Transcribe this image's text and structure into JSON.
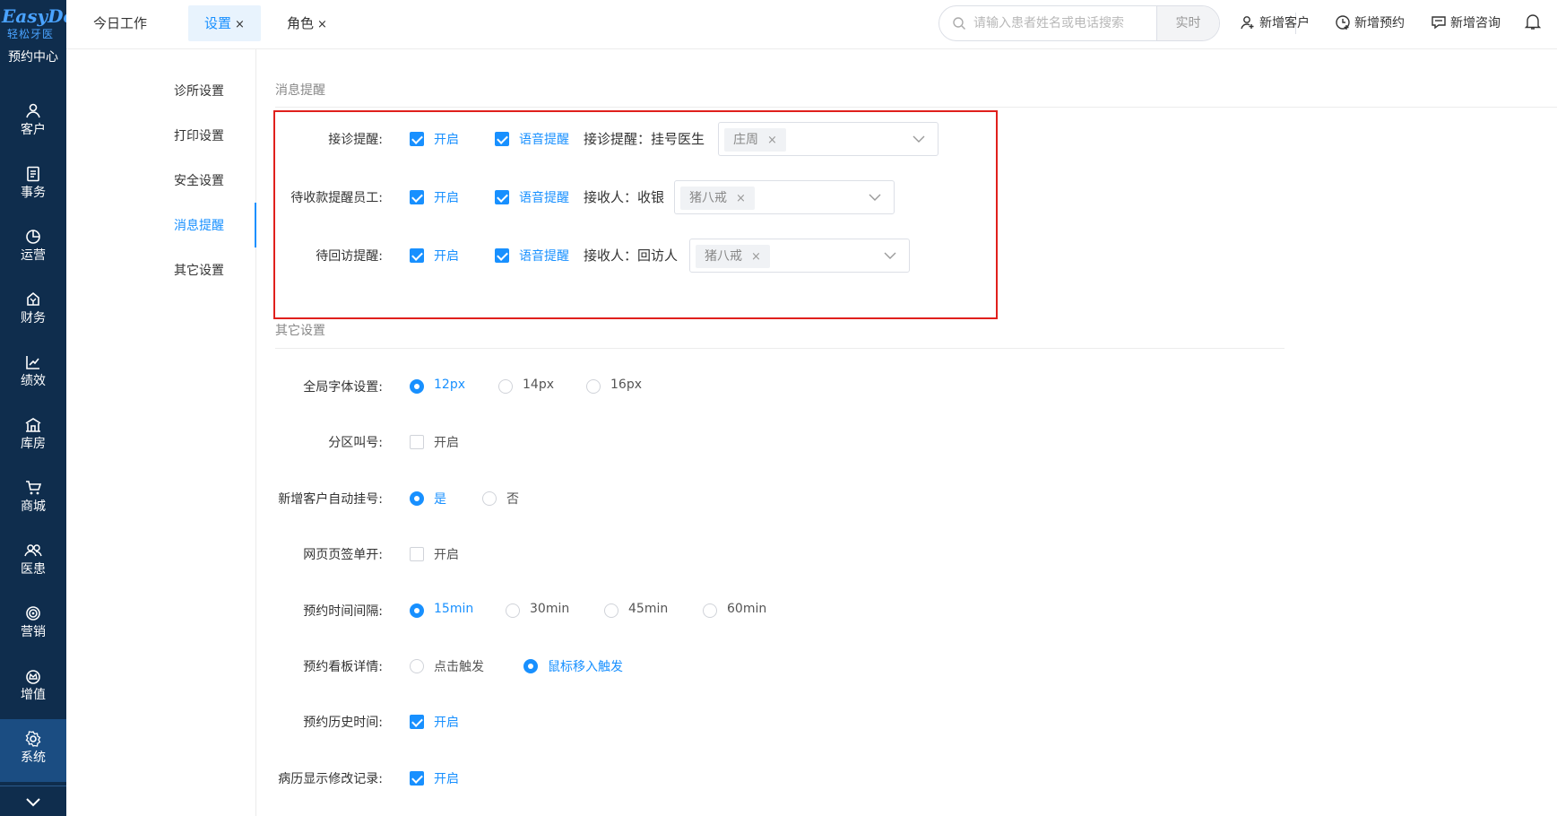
{
  "brand": {
    "name": "EasyDent",
    "subtitle": "轻松牙医"
  },
  "leftnav": {
    "appointment_center": "预约中心",
    "items": [
      {
        "label": "客户",
        "icon": "user-icon"
      },
      {
        "label": "事务",
        "icon": "document-icon"
      },
      {
        "label": "运营",
        "icon": "pie-chart-icon"
      },
      {
        "label": "财务",
        "icon": "money-icon"
      },
      {
        "label": "绩效",
        "icon": "trend-icon"
      },
      {
        "label": "库房",
        "icon": "warehouse-icon"
      },
      {
        "label": "商城",
        "icon": "cart-icon"
      },
      {
        "label": "医患",
        "icon": "doctor-patient-icon"
      },
      {
        "label": "营销",
        "icon": "target-icon"
      },
      {
        "label": "增值",
        "icon": "crown-icon"
      },
      {
        "label": "系统",
        "icon": "gear-icon"
      }
    ],
    "active_index": 10
  },
  "tabs": [
    {
      "label": "今日工作",
      "closable": false
    },
    {
      "label": "设置",
      "closable": true,
      "active": true
    },
    {
      "label": "角色",
      "closable": true
    }
  ],
  "tab_close_glyph": "×",
  "search": {
    "placeholder": "请输入患者姓名或电话搜索",
    "button": "实时"
  },
  "actions": {
    "new_customer": "新增客户",
    "new_appointment": "新增预约",
    "new_consult": "新增咨询"
  },
  "submenu": [
    {
      "label": "诊所设置"
    },
    {
      "label": "打印设置"
    },
    {
      "label": "安全设置"
    },
    {
      "label": "消息提醒",
      "active": true
    },
    {
      "label": "其它设置"
    }
  ],
  "message_section": {
    "title": "消息提醒",
    "rows": [
      {
        "label": "接诊提醒:",
        "enable_text": "开启",
        "voice_text": "语音提醒",
        "receiver_label": "接诊提醒：挂号医生",
        "tag": "庄周"
      },
      {
        "label": "待收款提醒员工:",
        "enable_text": "开启",
        "voice_text": "语音提醒",
        "receiver_label": "接收人：收银",
        "tag": "猪八戒"
      },
      {
        "label": "待回访提醒:",
        "enable_text": "开启",
        "voice_text": "语音提醒",
        "receiver_label": "接收人：回访人",
        "tag": "猪八戒"
      }
    ]
  },
  "other_section": {
    "title": "其它设置",
    "font_size": {
      "label": "全局字体设置:",
      "options": [
        "12px",
        "14px",
        "16px"
      ],
      "selected": 0
    },
    "zone_call": {
      "label": "分区叫号:",
      "text": "开启",
      "checked": false
    },
    "auto_register": {
      "label": "新增客户自动挂号:",
      "options": [
        "是",
        "否"
      ],
      "selected": 0
    },
    "single_tab": {
      "label": "网页页签单开:",
      "text": "开启",
      "checked": false
    },
    "interval": {
      "label": "预约时间间隔:",
      "options": [
        "15min",
        "30min",
        "45min",
        "60min"
      ],
      "selected": 0
    },
    "board_detail": {
      "label": "预约看板详情:",
      "options": [
        "点击触发",
        "鼠标移入触发"
      ],
      "selected": 1
    },
    "history_time": {
      "label": "预约历史时间:",
      "text": "开启",
      "checked": true
    },
    "record_changes": {
      "label": "病历显示修改记录:",
      "text": "开启",
      "checked": true
    }
  },
  "colors": {
    "accent": "#1890ff",
    "nav_bg": "#0f2d4d",
    "nav_active": "#1b4d82",
    "highlight_box": "#e0201c"
  }
}
